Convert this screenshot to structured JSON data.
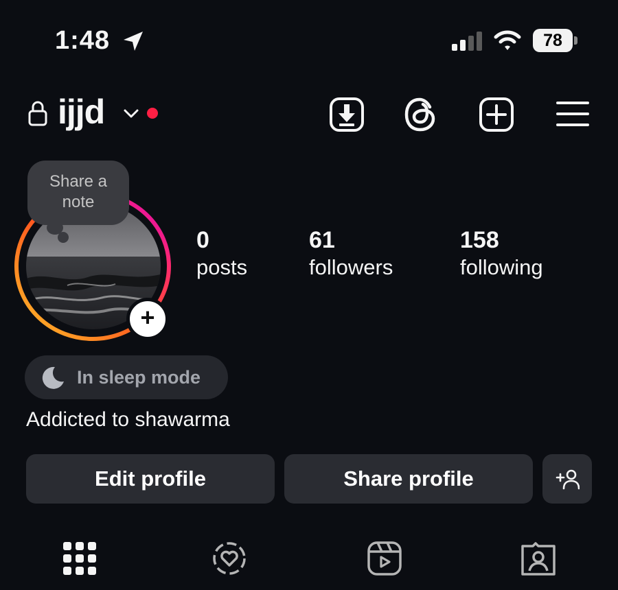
{
  "status_bar": {
    "time": "1:48",
    "battery": "78"
  },
  "header": {
    "username": "ijjd",
    "icons": [
      "lock-icon",
      "chevron-down-icon",
      "download-icon",
      "threads-icon",
      "create-plus-icon",
      "menu-icon"
    ]
  },
  "profile": {
    "note_line1": "Share a",
    "note_line2": "note",
    "stats": [
      {
        "value": "0",
        "label": "posts"
      },
      {
        "value": "61",
        "label": "followers"
      },
      {
        "value": "158",
        "label": "following"
      }
    ],
    "status_label": "In sleep mode",
    "bio": "Addicted to shawarma"
  },
  "actions": {
    "edit_profile": "Edit profile",
    "share_profile": "Share profile"
  },
  "tabs": [
    "grid-icon",
    "reposts-icon",
    "reels-icon",
    "tagged-icon"
  ],
  "colors": {
    "background": "#0b0d12",
    "button": "#2a2c32",
    "notification_dot": "#ff1f44",
    "ring_start": "#ffc229",
    "ring_end": "#d300c5"
  }
}
